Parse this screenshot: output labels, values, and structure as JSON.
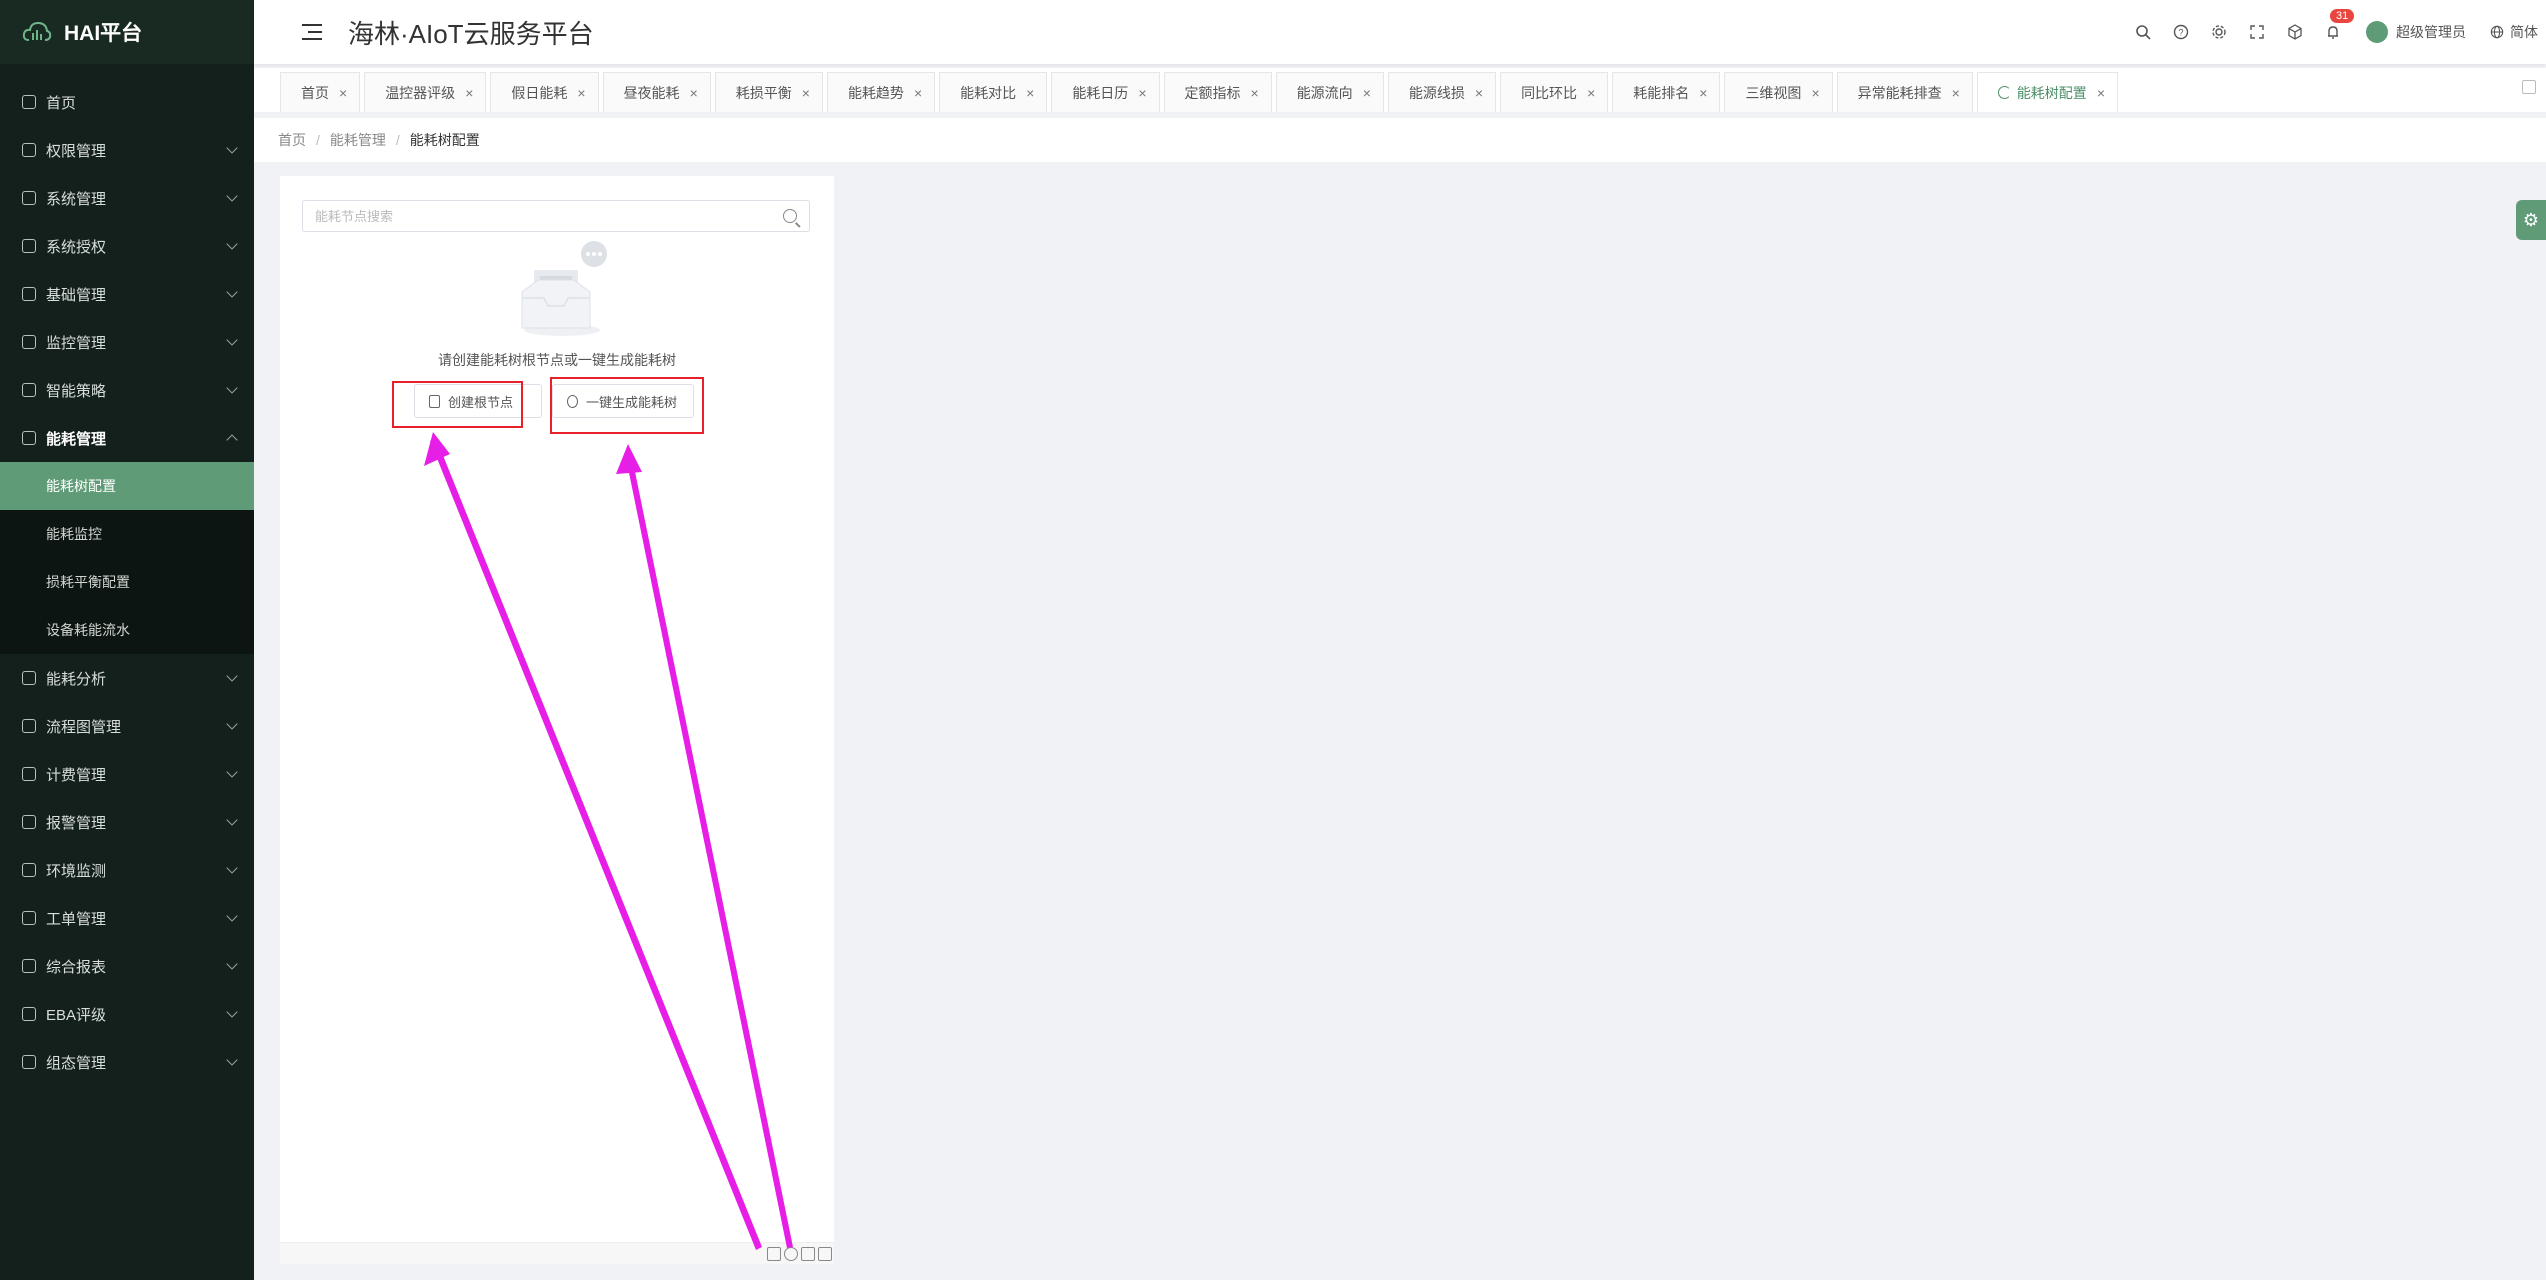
{
  "brand": {
    "name": "HAI平台"
  },
  "header": {
    "title": "海林·AIoT云服务平台",
    "notification_count": "31",
    "user_name": "超级管理员",
    "language": "简体"
  },
  "sidebar": {
    "items": [
      {
        "label": "首页"
      },
      {
        "label": "权限管理"
      },
      {
        "label": "系统管理"
      },
      {
        "label": "系统授权"
      },
      {
        "label": "基础管理"
      },
      {
        "label": "监控管理"
      },
      {
        "label": "智能策略"
      },
      {
        "label": "能耗管理",
        "open": true,
        "children": [
          {
            "label": "能耗树配置",
            "active": true
          },
          {
            "label": "能耗监控"
          },
          {
            "label": "损耗平衡配置"
          },
          {
            "label": "设备耗能流水"
          }
        ]
      },
      {
        "label": "能耗分析"
      },
      {
        "label": "流程图管理"
      },
      {
        "label": "计费管理"
      },
      {
        "label": "报警管理"
      },
      {
        "label": "环境监测"
      },
      {
        "label": "工单管理"
      },
      {
        "label": "综合报表"
      },
      {
        "label": "EBA评级"
      },
      {
        "label": "组态管理"
      }
    ]
  },
  "tabs": [
    {
      "label": "首页"
    },
    {
      "label": "温控器评级"
    },
    {
      "label": "假日能耗"
    },
    {
      "label": "昼夜能耗"
    },
    {
      "label": "耗损平衡"
    },
    {
      "label": "能耗趋势"
    },
    {
      "label": "能耗对比"
    },
    {
      "label": "能耗日历"
    },
    {
      "label": "定额指标"
    },
    {
      "label": "能源流向"
    },
    {
      "label": "能源线损"
    },
    {
      "label": "同比环比"
    },
    {
      "label": "耗能排名"
    },
    {
      "label": "三维视图"
    },
    {
      "label": "异常能耗排查"
    },
    {
      "label": "能耗树配置",
      "active": true
    }
  ],
  "tab_close_glyph": "×",
  "breadcrumb": {
    "home": "首页",
    "section": "能耗管理",
    "current": "能耗树配置",
    "separator": "/"
  },
  "panel": {
    "search_placeholder": "能耗节点搜索",
    "empty_text": "请创建能耗树根节点或一键生成能耗树",
    "create_button": "创建根节点",
    "generate_button": "一键生成能耗树"
  },
  "colors": {
    "accent": "#5e9b76",
    "sidebar_bg": "#14201b",
    "annotation_box": "#e6212a",
    "annotation_arrow": "#e61ee6"
  }
}
